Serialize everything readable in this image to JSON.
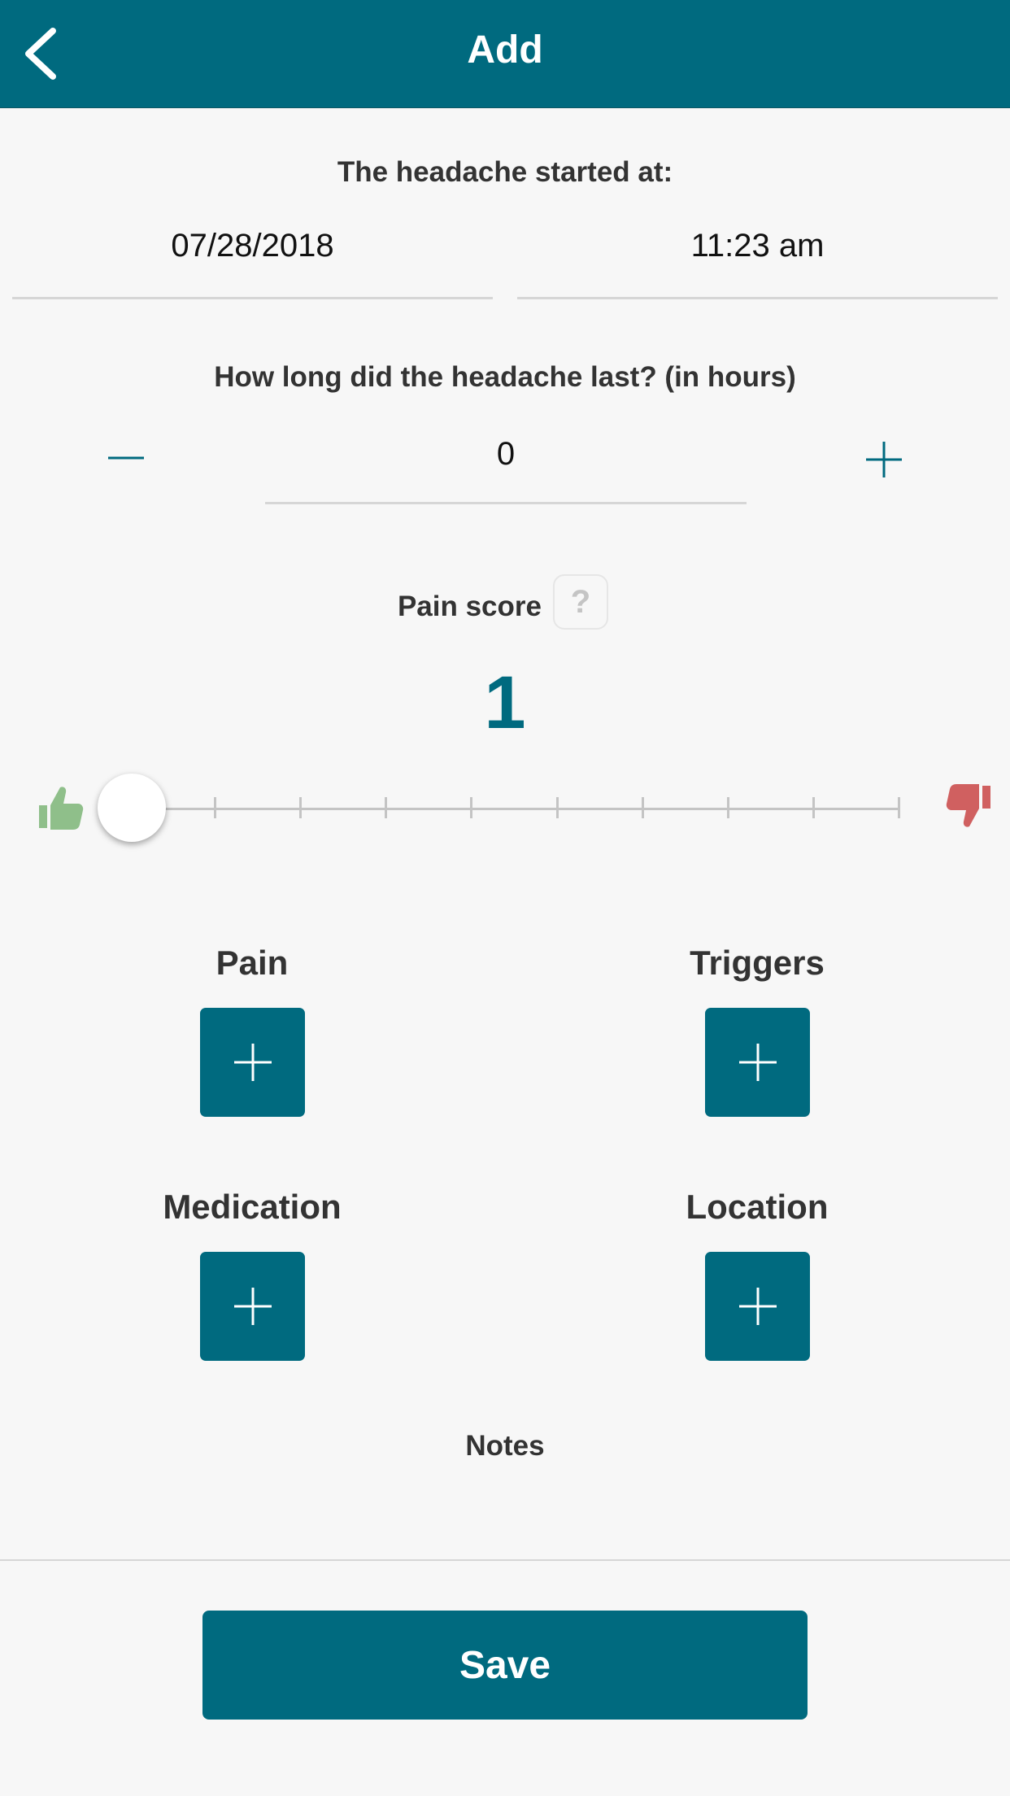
{
  "header": {
    "title": "Add",
    "back_icon": "chevron-left-icon",
    "background": "#006a7f"
  },
  "start": {
    "label": "The headache started at:",
    "date": "07/28/2018",
    "time": "11:23 am"
  },
  "duration": {
    "label": "How long did the headache last? (in hours)",
    "value": "0",
    "decrement_icon": "minus-icon",
    "increment_icon": "plus-icon"
  },
  "pain_score": {
    "label": "Pain score",
    "help_label": "?",
    "value": "1",
    "min": 1,
    "max": 10,
    "low_icon": "thumbs-up-icon",
    "high_icon": "thumbs-down-icon",
    "low_color": "#8fbf8a",
    "high_color": "#d06060"
  },
  "categories": {
    "pain": {
      "label": "Pain",
      "icon": "plus-icon"
    },
    "triggers": {
      "label": "Triggers",
      "icon": "plus-icon"
    },
    "medication": {
      "label": "Medication",
      "icon": "plus-icon"
    },
    "location": {
      "label": "Location",
      "icon": "plus-icon"
    }
  },
  "notes": {
    "label": "Notes",
    "value": ""
  },
  "save_label": "Save",
  "accent_color": "#006a7f"
}
